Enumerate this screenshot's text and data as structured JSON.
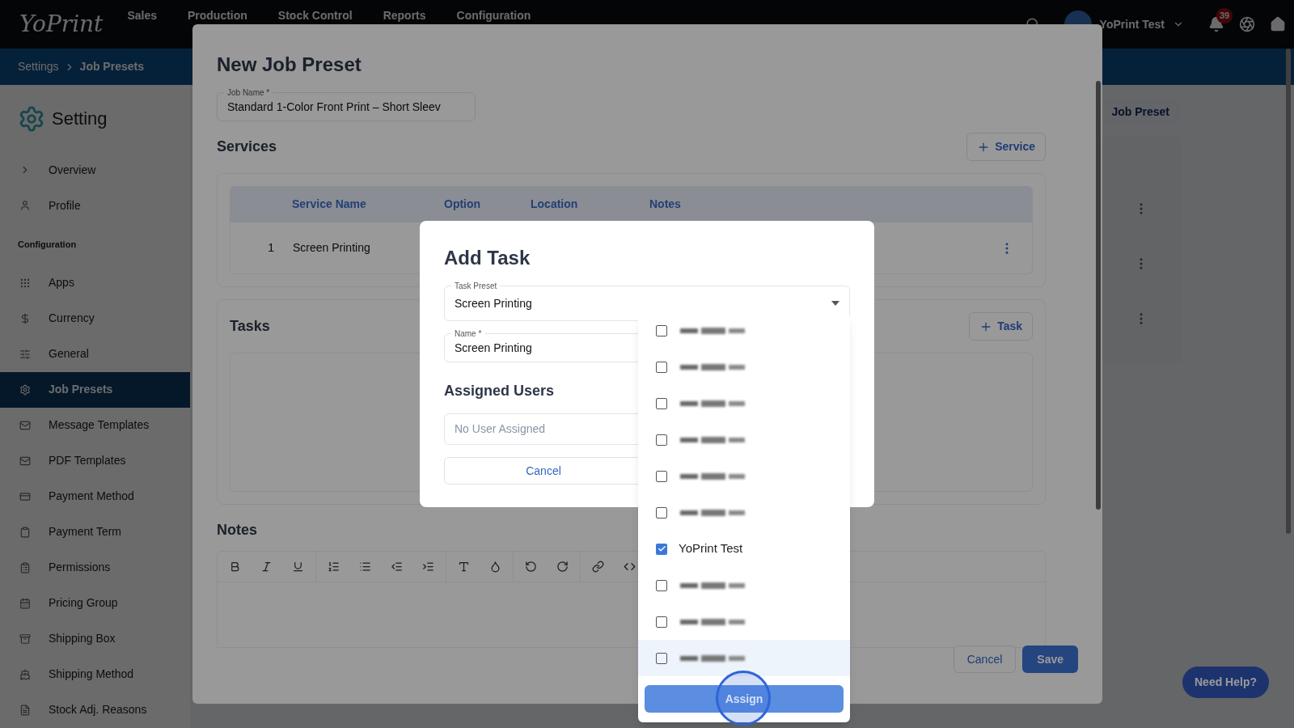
{
  "top_bar": {
    "logo": "YoPrint",
    "nav": [
      "Sales",
      "Production",
      "Stock Control",
      "Reports",
      "Configuration"
    ],
    "user": "YoPrint Test",
    "notification_count": "39"
  },
  "breadcrumb": [
    "Settings",
    "Job Presets"
  ],
  "sidebar": {
    "title": "Setting",
    "top_items": [
      {
        "label": "Overview",
        "selected": false
      },
      {
        "label": "Profile",
        "selected": false
      }
    ],
    "section_title": "Configuration",
    "items": [
      {
        "label": "Apps",
        "selected": false
      },
      {
        "label": "Currency",
        "selected": false
      },
      {
        "label": "General",
        "selected": false
      },
      {
        "label": "Job Presets",
        "selected": true
      },
      {
        "label": "Message Templates",
        "selected": false
      },
      {
        "label": "PDF Templates",
        "selected": false
      },
      {
        "label": "Payment Method",
        "selected": false
      },
      {
        "label": "Payment Term",
        "selected": false
      },
      {
        "label": "Permissions",
        "selected": false
      },
      {
        "label": "Pricing Group",
        "selected": false
      },
      {
        "label": "Shipping Box",
        "selected": false
      },
      {
        "label": "Shipping Method",
        "selected": false
      },
      {
        "label": "Stock Adj. Reasons",
        "selected": false
      }
    ]
  },
  "page": {
    "add_button": "Job Preset"
  },
  "job_preset_dialog": {
    "title": "New Job Preset",
    "job_name": {
      "label": "Job Name *",
      "value": "Standard 1-Color Front Print – Short Sleev"
    },
    "services": {
      "title": "Services",
      "add_button": "Service",
      "columns": [
        "Service Name",
        "Option",
        "Location",
        "Notes"
      ],
      "rows": [
        {
          "index": "1",
          "service_name": "Screen Printing"
        }
      ]
    },
    "tasks": {
      "title": "Tasks",
      "add_button": "Task"
    },
    "notes": {
      "title": "Notes"
    },
    "cancel_button": "Cancel",
    "save_button": "Save"
  },
  "add_task_dialog": {
    "title": "Add Task",
    "task_preset": {
      "label": "Task Preset",
      "value": "Screen Printing"
    },
    "name": {
      "label": "Name *",
      "value": "Screen Printing"
    },
    "assigned_users_title": "Assigned Users",
    "assigned_users": {
      "placeholder": "No User Assigned"
    },
    "cancel_button": "Cancel"
  },
  "user_menu": {
    "items": [
      {
        "kind": "redacted",
        "checked": false,
        "highlighted": false
      },
      {
        "kind": "redacted",
        "checked": false,
        "highlighted": false
      },
      {
        "kind": "redacted",
        "checked": false,
        "highlighted": false
      },
      {
        "kind": "redacted",
        "checked": false,
        "highlighted": false
      },
      {
        "kind": "redacted",
        "checked": false,
        "highlighted": false
      },
      {
        "kind": "redacted",
        "checked": false,
        "highlighted": false
      },
      {
        "kind": "name",
        "label": "YoPrint Test",
        "checked": true,
        "highlighted": false
      },
      {
        "kind": "redacted",
        "checked": false,
        "highlighted": false
      },
      {
        "kind": "redacted",
        "checked": false,
        "highlighted": false
      },
      {
        "kind": "redacted",
        "checked": false,
        "highlighted": true
      }
    ],
    "assign_button": "Assign"
  },
  "help_button": "Need Help?"
}
